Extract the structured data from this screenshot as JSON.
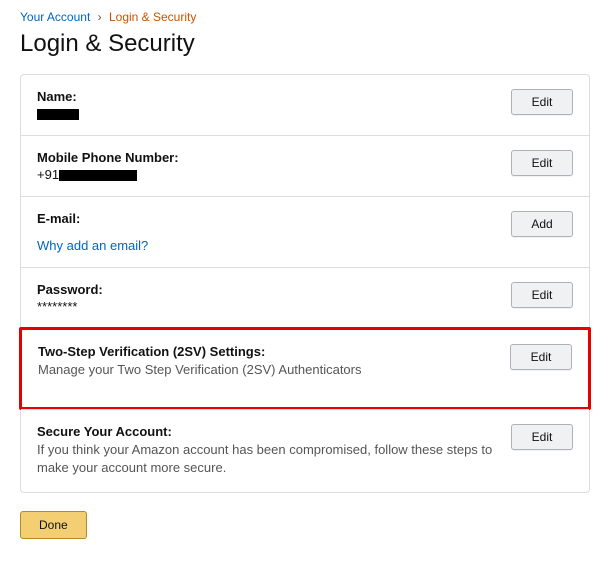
{
  "breadcrumb": {
    "root": "Your Account",
    "sep": "›",
    "current": "Login & Security"
  },
  "page_title": "Login & Security",
  "rows": {
    "name": {
      "label": "Name:",
      "button": "Edit"
    },
    "phone": {
      "label": "Mobile Phone Number:",
      "prefix": "+91",
      "button": "Edit"
    },
    "email": {
      "label": "E-mail:",
      "link": "Why add an email?",
      "button": "Add"
    },
    "password": {
      "label": "Password:",
      "value": "********",
      "button": "Edit"
    },
    "twosv": {
      "label": "Two-Step Verification (2SV) Settings:",
      "desc": "Manage your Two Step Verification (2SV) Authenticators",
      "button": "Edit"
    },
    "secure": {
      "label": "Secure Your Account:",
      "desc": "If you think your Amazon account has been compromised, follow these steps to make your account more secure.",
      "button": "Edit"
    }
  },
  "done_label": "Done"
}
